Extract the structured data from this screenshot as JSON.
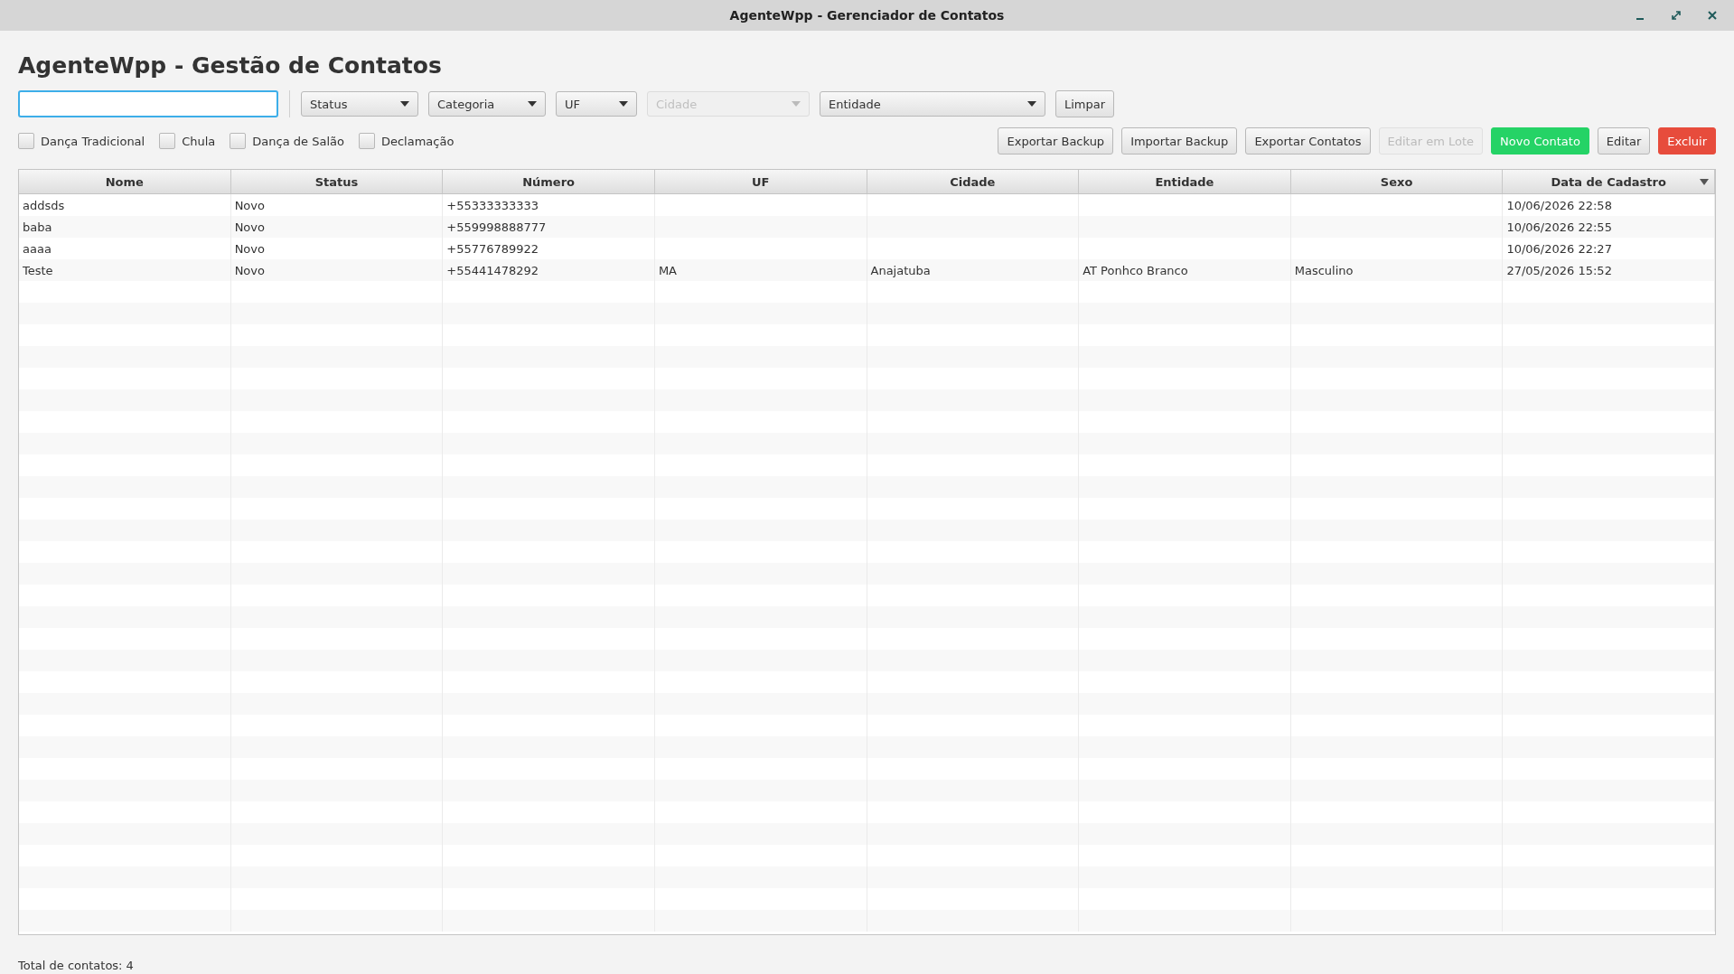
{
  "window": {
    "title": "AgenteWpp - Gerenciador de Contatos"
  },
  "heading": "AgenteWpp - Gestão de Contatos",
  "filters": [
    {
      "label": "Status",
      "disabled": false
    },
    {
      "label": "Categoria",
      "disabled": false
    },
    {
      "label": "UF",
      "disabled": false
    },
    {
      "label": "Cidade",
      "disabled": true
    },
    {
      "label": "Entidade",
      "disabled": false
    }
  ],
  "clear_button": "Limpar",
  "categories": [
    {
      "label": "Dança Tradicional",
      "checked": false
    },
    {
      "label": "Chula",
      "checked": false
    },
    {
      "label": "Dança de Salão",
      "checked": false
    },
    {
      "label": "Declamação",
      "checked": false
    }
  ],
  "actions": [
    {
      "label": "Exportar Backup",
      "kind": "normal",
      "disabled": false
    },
    {
      "label": "Importar Backup",
      "kind": "normal",
      "disabled": false
    },
    {
      "label": "Exportar Contatos",
      "kind": "normal",
      "disabled": false
    },
    {
      "label": "Editar em Lote",
      "kind": "normal",
      "disabled": true
    },
    {
      "label": "Novo Contato",
      "kind": "primary",
      "disabled": false
    },
    {
      "label": "Editar",
      "kind": "normal",
      "disabled": false
    },
    {
      "label": "Excluir",
      "kind": "danger",
      "disabled": false
    }
  ],
  "table": {
    "columns": [
      {
        "label": "Nome",
        "sorted": false
      },
      {
        "label": "Status",
        "sorted": false
      },
      {
        "label": "Número",
        "sorted": false
      },
      {
        "label": "UF",
        "sorted": false
      },
      {
        "label": "Cidade",
        "sorted": false
      },
      {
        "label": "Entidade",
        "sorted": false
      },
      {
        "label": "Sexo",
        "sorted": false
      },
      {
        "label": "Data de Cadastro",
        "sorted": true
      }
    ],
    "rows": [
      [
        "addsds",
        "Novo",
        "+55333333333",
        "",
        "",
        "",
        "",
        "10/06/2026 22:58"
      ],
      [
        "baba",
        "Novo",
        "+559998888777",
        "",
        "",
        "",
        "",
        "10/06/2026 22:55"
      ],
      [
        "aaaa",
        "Novo",
        "+55776789922",
        "",
        "",
        "",
        "",
        "10/06/2026 22:27"
      ],
      [
        "Teste",
        "Novo",
        "+55441478292",
        "MA",
        "Anajatuba",
        "AT Ponhco Branco",
        "Masculino",
        "27/05/2026 15:52"
      ]
    ]
  },
  "status_bar": "Total de contatos: 4"
}
